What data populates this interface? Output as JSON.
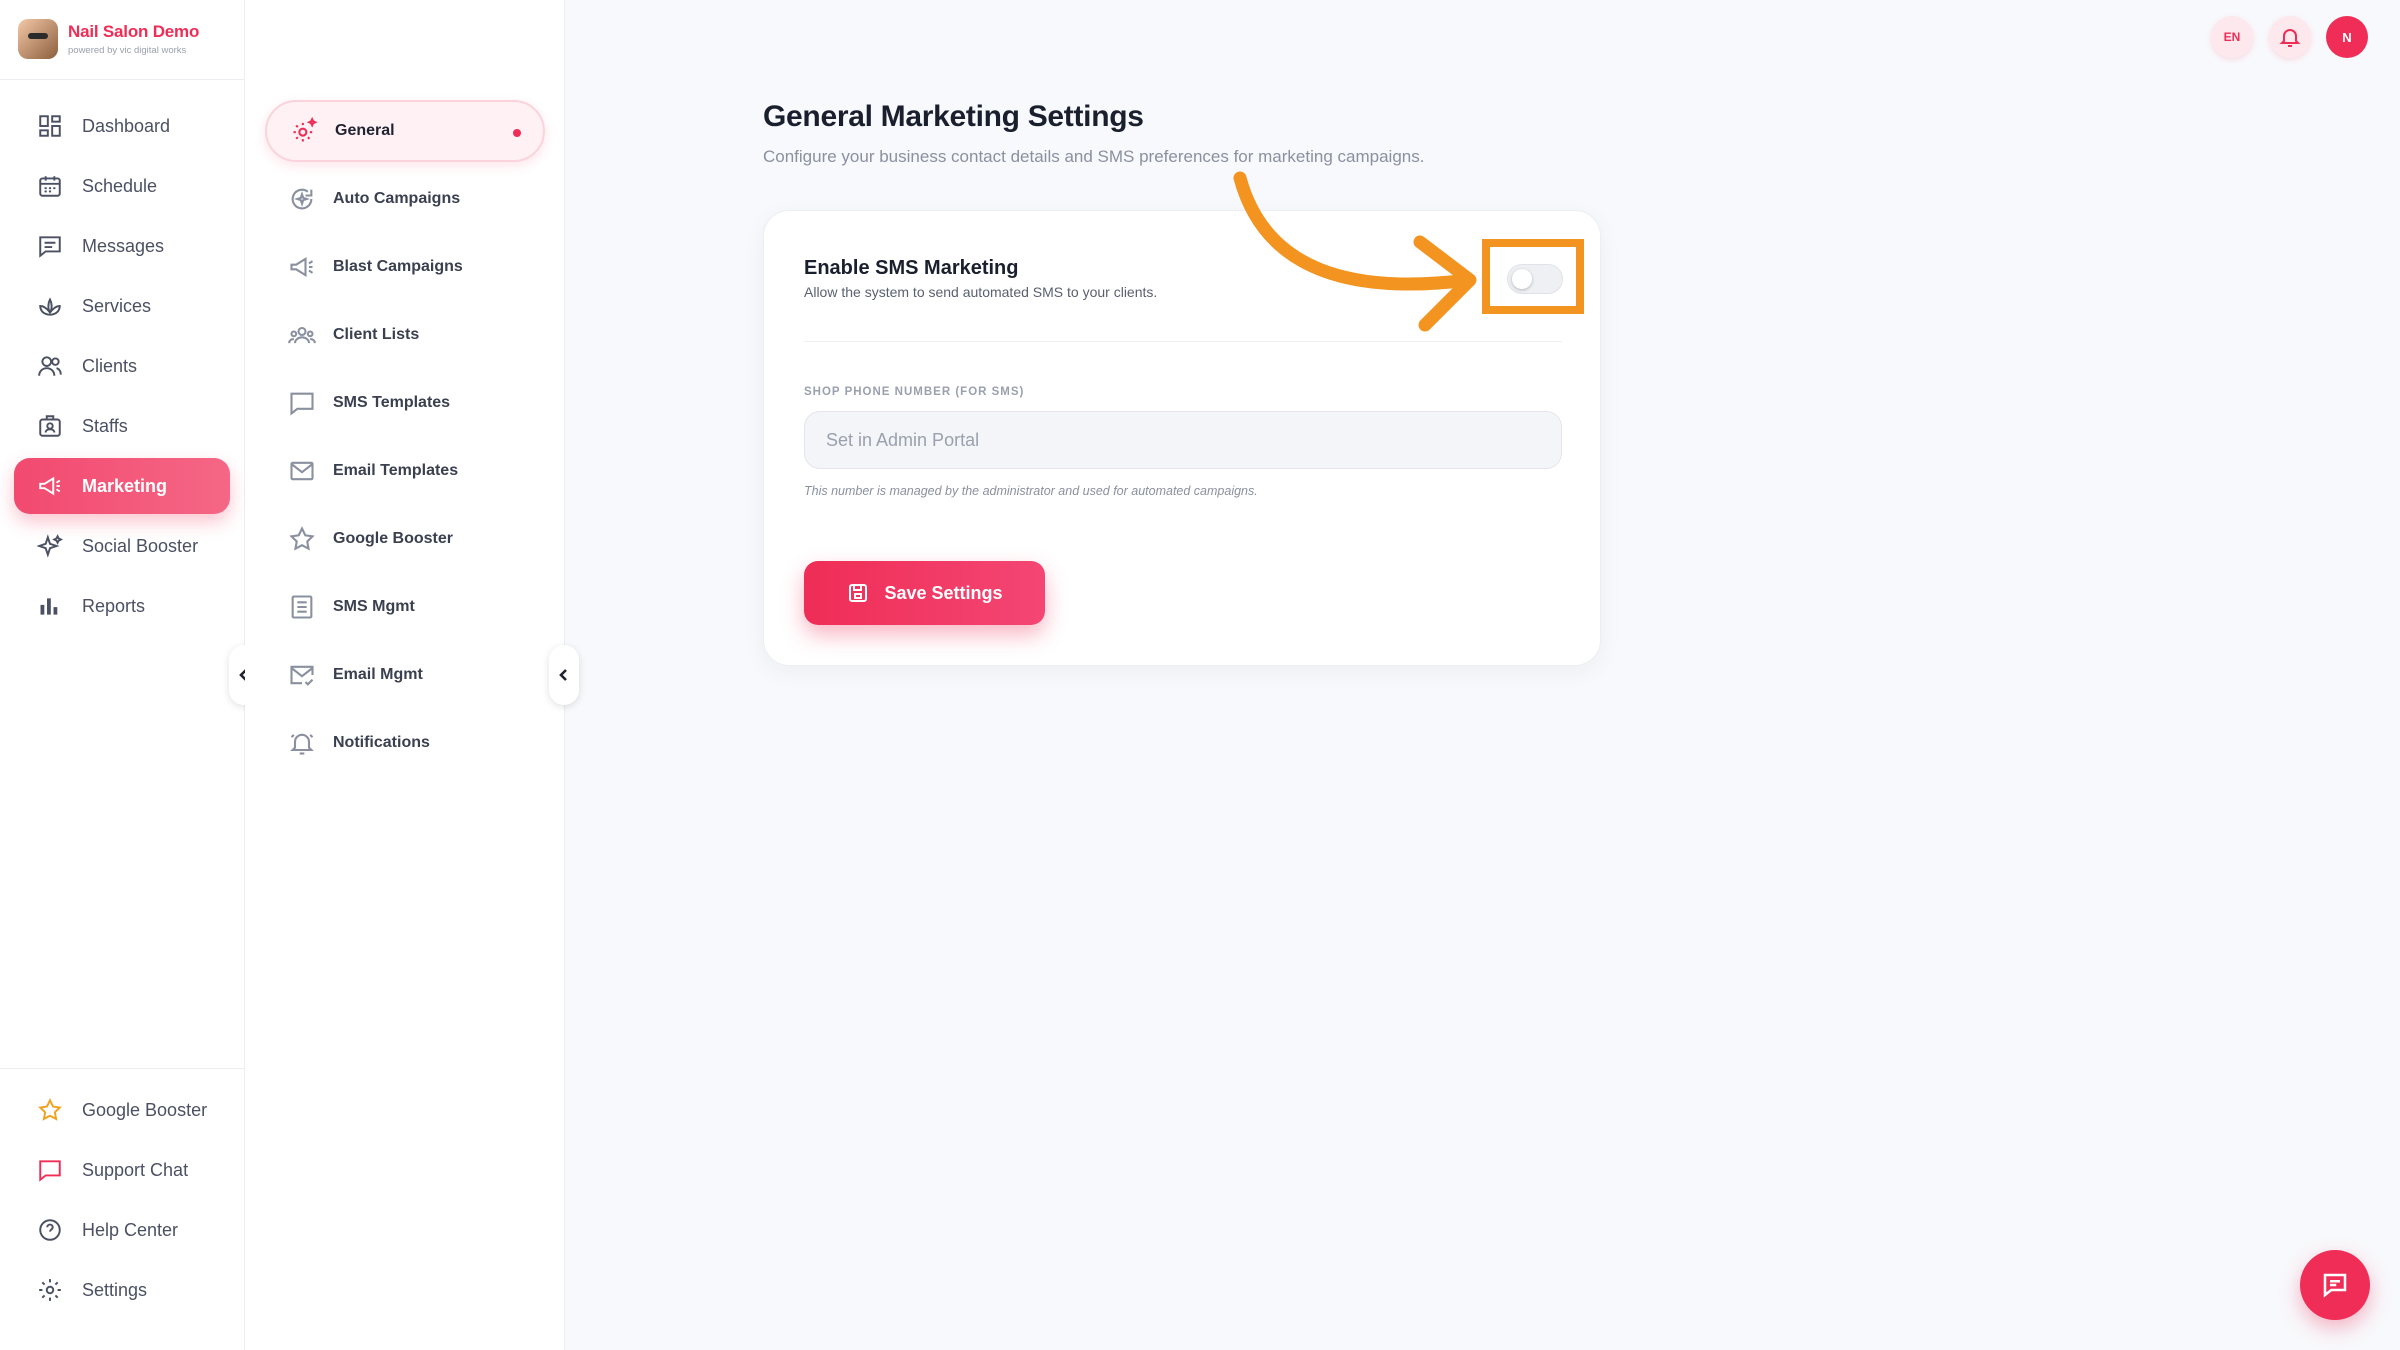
{
  "brand": {
    "name": "Nail Salon Demo",
    "tagline": "powered by vic digital works"
  },
  "sidebar": {
    "items": [
      {
        "label": "Dashboard",
        "icon": "dashboard-icon"
      },
      {
        "label": "Schedule",
        "icon": "calendar-icon"
      },
      {
        "label": "Messages",
        "icon": "messages-icon"
      },
      {
        "label": "Services",
        "icon": "lotus-icon"
      },
      {
        "label": "Clients",
        "icon": "users-icon"
      },
      {
        "label": "Staffs",
        "icon": "id-badge-icon"
      },
      {
        "label": "Marketing",
        "icon": "megaphone-icon",
        "active": true
      },
      {
        "label": "Social Booster",
        "icon": "sparkles-icon"
      },
      {
        "label": "Reports",
        "icon": "bar-chart-icon"
      }
    ],
    "bottom": [
      {
        "label": "Google Booster",
        "icon": "star-icon"
      },
      {
        "label": "Support Chat",
        "icon": "chat-icon"
      },
      {
        "label": "Help Center",
        "icon": "help-icon"
      },
      {
        "label": "Settings",
        "icon": "gear-icon"
      }
    ]
  },
  "subnav": {
    "items": [
      {
        "label": "General",
        "icon": "gear-sparkle-icon",
        "active": true
      },
      {
        "label": "Auto Campaigns",
        "icon": "auto-cycle-icon"
      },
      {
        "label": "Blast Campaigns",
        "icon": "megaphone-icon"
      },
      {
        "label": "Client Lists",
        "icon": "group-icon"
      },
      {
        "label": "SMS Templates",
        "icon": "message-square-icon"
      },
      {
        "label": "Email Templates",
        "icon": "mail-icon"
      },
      {
        "label": "Google Booster",
        "icon": "star-icon"
      },
      {
        "label": "SMS Mgmt",
        "icon": "list-icon"
      },
      {
        "label": "Email Mgmt",
        "icon": "mail-check-icon"
      },
      {
        "label": "Notifications",
        "icon": "bell-ring-icon"
      }
    ]
  },
  "topbar": {
    "language": "EN",
    "user_initial": "N"
  },
  "main": {
    "title": "General Marketing Settings",
    "subtitle": "Configure your business contact details and SMS preferences for marketing campaigns.",
    "sms_toggle": {
      "title": "Enable SMS Marketing",
      "description": "Allow the system to send automated SMS to your clients.",
      "enabled": false
    },
    "phone": {
      "label": "SHOP PHONE NUMBER (FOR SMS)",
      "placeholder": "Set in Admin Portal",
      "help": "This number is managed by the administrator and used for automated campaigns."
    },
    "save_label": "Save Settings"
  },
  "colors": {
    "accent": "#ef2d56",
    "annotation": "#f2941f"
  }
}
